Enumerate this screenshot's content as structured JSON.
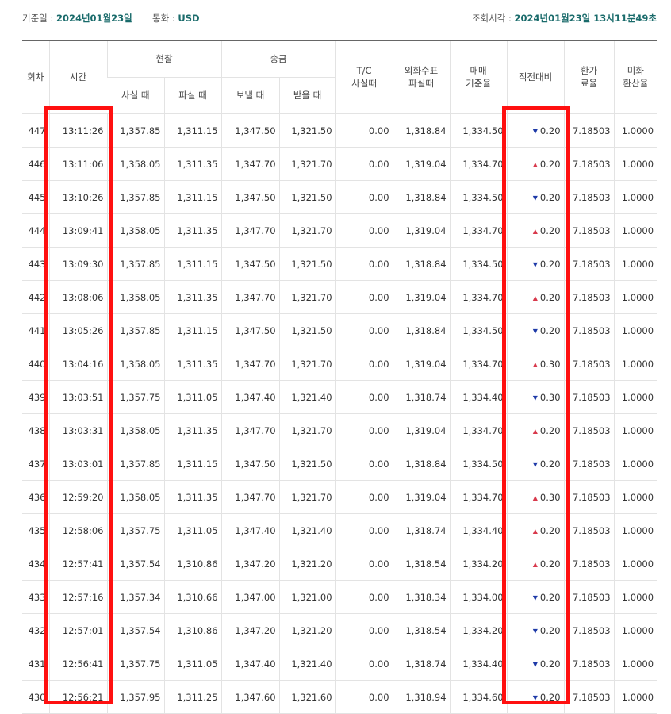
{
  "topbar": {
    "base_date_label": "기준일 : ",
    "base_date_value": "2024년01월23일",
    "currency_label": "통화 : ",
    "currency_value": "USD",
    "query_time_label": "조회시각 : ",
    "query_time_value": "2024년01월23일 13시11분49초"
  },
  "headers": {
    "round": "회차",
    "time": "시간",
    "cash": "현찰",
    "cash_buy": "사실 때",
    "cash_sell": "파실 때",
    "remit": "송금",
    "remit_send": "보낼 때",
    "remit_receive": "받을 때",
    "tc_line1": "T/C",
    "tc_line2": "사실때",
    "check_line1": "외화수표",
    "check_line2": "파실때",
    "base_rate_line1": "매매",
    "base_rate_line2": "기준율",
    "diff": "직전대비",
    "exch_rate_line1": "환가",
    "exch_rate_line2": "료율",
    "usd_rate_line1": "미화",
    "usd_rate_line2": "환산율"
  },
  "rows": [
    {
      "round": "447",
      "time": "13:11:26",
      "cash_buy": "1,357.85",
      "cash_sell": "1,311.15",
      "send": "1,347.50",
      "receive": "1,321.50",
      "tc": "0.00",
      "check": "1,318.84",
      "base": "1,334.50",
      "dir": "down",
      "diff": "0.20",
      "exch": "7.18503",
      "usd": "1.0000"
    },
    {
      "round": "446",
      "time": "13:11:06",
      "cash_buy": "1,358.05",
      "cash_sell": "1,311.35",
      "send": "1,347.70",
      "receive": "1,321.70",
      "tc": "0.00",
      "check": "1,319.04",
      "base": "1,334.70",
      "dir": "up",
      "diff": "0.20",
      "exch": "7.18503",
      "usd": "1.0000"
    },
    {
      "round": "445",
      "time": "13:10:26",
      "cash_buy": "1,357.85",
      "cash_sell": "1,311.15",
      "send": "1,347.50",
      "receive": "1,321.50",
      "tc": "0.00",
      "check": "1,318.84",
      "base": "1,334.50",
      "dir": "down",
      "diff": "0.20",
      "exch": "7.18503",
      "usd": "1.0000"
    },
    {
      "round": "444",
      "time": "13:09:41",
      "cash_buy": "1,358.05",
      "cash_sell": "1,311.35",
      "send": "1,347.70",
      "receive": "1,321.70",
      "tc": "0.00",
      "check": "1,319.04",
      "base": "1,334.70",
      "dir": "up",
      "diff": "0.20",
      "exch": "7.18503",
      "usd": "1.0000"
    },
    {
      "round": "443",
      "time": "13:09:30",
      "cash_buy": "1,357.85",
      "cash_sell": "1,311.15",
      "send": "1,347.50",
      "receive": "1,321.50",
      "tc": "0.00",
      "check": "1,318.84",
      "base": "1,334.50",
      "dir": "down",
      "diff": "0.20",
      "exch": "7.18503",
      "usd": "1.0000"
    },
    {
      "round": "442",
      "time": "13:08:06",
      "cash_buy": "1,358.05",
      "cash_sell": "1,311.35",
      "send": "1,347.70",
      "receive": "1,321.70",
      "tc": "0.00",
      "check": "1,319.04",
      "base": "1,334.70",
      "dir": "up",
      "diff": "0.20",
      "exch": "7.18503",
      "usd": "1.0000"
    },
    {
      "round": "441",
      "time": "13:05:26",
      "cash_buy": "1,357.85",
      "cash_sell": "1,311.15",
      "send": "1,347.50",
      "receive": "1,321.50",
      "tc": "0.00",
      "check": "1,318.84",
      "base": "1,334.50",
      "dir": "down",
      "diff": "0.20",
      "exch": "7.18503",
      "usd": "1.0000"
    },
    {
      "round": "440",
      "time": "13:04:16",
      "cash_buy": "1,358.05",
      "cash_sell": "1,311.35",
      "send": "1,347.70",
      "receive": "1,321.70",
      "tc": "0.00",
      "check": "1,319.04",
      "base": "1,334.70",
      "dir": "up",
      "diff": "0.30",
      "exch": "7.18503",
      "usd": "1.0000"
    },
    {
      "round": "439",
      "time": "13:03:51",
      "cash_buy": "1,357.75",
      "cash_sell": "1,311.05",
      "send": "1,347.40",
      "receive": "1,321.40",
      "tc": "0.00",
      "check": "1,318.74",
      "base": "1,334.40",
      "dir": "down",
      "diff": "0.30",
      "exch": "7.18503",
      "usd": "1.0000"
    },
    {
      "round": "438",
      "time": "13:03:31",
      "cash_buy": "1,358.05",
      "cash_sell": "1,311.35",
      "send": "1,347.70",
      "receive": "1,321.70",
      "tc": "0.00",
      "check": "1,319.04",
      "base": "1,334.70",
      "dir": "up",
      "diff": "0.20",
      "exch": "7.18503",
      "usd": "1.0000"
    },
    {
      "round": "437",
      "time": "13:03:01",
      "cash_buy": "1,357.85",
      "cash_sell": "1,311.15",
      "send": "1,347.50",
      "receive": "1,321.50",
      "tc": "0.00",
      "check": "1,318.84",
      "base": "1,334.50",
      "dir": "down",
      "diff": "0.20",
      "exch": "7.18503",
      "usd": "1.0000"
    },
    {
      "round": "436",
      "time": "12:59:20",
      "cash_buy": "1,358.05",
      "cash_sell": "1,311.35",
      "send": "1,347.70",
      "receive": "1,321.70",
      "tc": "0.00",
      "check": "1,319.04",
      "base": "1,334.70",
      "dir": "up",
      "diff": "0.30",
      "exch": "7.18503",
      "usd": "1.0000"
    },
    {
      "round": "435",
      "time": "12:58:06",
      "cash_buy": "1,357.75",
      "cash_sell": "1,311.05",
      "send": "1,347.40",
      "receive": "1,321.40",
      "tc": "0.00",
      "check": "1,318.74",
      "base": "1,334.40",
      "dir": "up",
      "diff": "0.20",
      "exch": "7.18503",
      "usd": "1.0000"
    },
    {
      "round": "434",
      "time": "12:57:41",
      "cash_buy": "1,357.54",
      "cash_sell": "1,310.86",
      "send": "1,347.20",
      "receive": "1,321.20",
      "tc": "0.00",
      "check": "1,318.54",
      "base": "1,334.20",
      "dir": "up",
      "diff": "0.20",
      "exch": "7.18503",
      "usd": "1.0000"
    },
    {
      "round": "433",
      "time": "12:57:16",
      "cash_buy": "1,357.34",
      "cash_sell": "1,310.66",
      "send": "1,347.00",
      "receive": "1,321.00",
      "tc": "0.00",
      "check": "1,318.34",
      "base": "1,334.00",
      "dir": "down",
      "diff": "0.20",
      "exch": "7.18503",
      "usd": "1.0000"
    },
    {
      "round": "432",
      "time": "12:57:01",
      "cash_buy": "1,357.54",
      "cash_sell": "1,310.86",
      "send": "1,347.20",
      "receive": "1,321.20",
      "tc": "0.00",
      "check": "1,318.54",
      "base": "1,334.20",
      "dir": "down",
      "diff": "0.20",
      "exch": "7.18503",
      "usd": "1.0000"
    },
    {
      "round": "431",
      "time": "12:56:41",
      "cash_buy": "1,357.75",
      "cash_sell": "1,311.05",
      "send": "1,347.40",
      "receive": "1,321.40",
      "tc": "0.00",
      "check": "1,318.74",
      "base": "1,334.40",
      "dir": "down",
      "diff": "0.20",
      "exch": "7.18503",
      "usd": "1.0000"
    },
    {
      "round": "430",
      "time": "12:56:21",
      "cash_buy": "1,357.95",
      "cash_sell": "1,311.25",
      "send": "1,347.60",
      "receive": "1,321.60",
      "tc": "0.00",
      "check": "1,318.94",
      "base": "1,334.60",
      "dir": "down",
      "diff": "0.20",
      "exch": "7.18503",
      "usd": "1.0000"
    }
  ],
  "icons": {
    "down": "triangle-down-icon",
    "up": "triangle-up-icon"
  },
  "colors": {
    "accent": "#1a6b6b",
    "down": "#1e3aa8",
    "up": "#d8394c",
    "highlight": "#ff1010"
  }
}
